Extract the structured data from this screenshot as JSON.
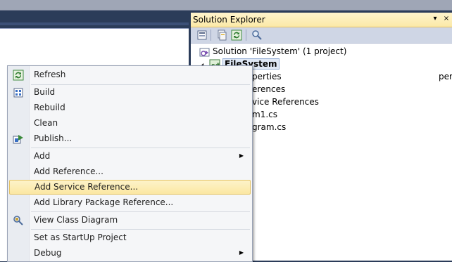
{
  "solution_explorer": {
    "title": "Solution Explorer",
    "pin_glyph": "▾",
    "autohide_glyph": "⊿",
    "close_glyph": "×",
    "toolbar_icons": [
      "properties-icon",
      "show-all-files-icon",
      "refresh-icon",
      "class-view-icon"
    ],
    "tree": [
      {
        "label": "Solution 'FileSystem' (1 project)",
        "icon": "solution-icon"
      },
      {
        "label": "FileSystem",
        "icon": "csharp-project-icon",
        "expander": "◢",
        "selected": true
      },
      {
        "label": "perties",
        "icon": ""
      },
      {
        "label": "erences",
        "icon": ""
      },
      {
        "label": "vice References",
        "icon": ""
      },
      {
        "label": "m1.cs",
        "icon": ""
      },
      {
        "label": "gram.cs",
        "icon": ""
      }
    ]
  },
  "context_menu": {
    "items": [
      {
        "label": "Refresh",
        "icon": "refresh-icon"
      },
      {
        "label": "Build",
        "icon": "build-icon"
      },
      {
        "label": "Rebuild",
        "icon": ""
      },
      {
        "label": "Clean",
        "icon": ""
      },
      {
        "label": "Publish...",
        "icon": "publish-icon"
      },
      {
        "label": "Add",
        "submenu": "▶"
      },
      {
        "label": "Add Reference...",
        "icon": ""
      },
      {
        "label": "Add Service Reference...",
        "icon": "",
        "highlighted": true
      },
      {
        "label": "Add Library Package Reference...",
        "icon": ""
      },
      {
        "label": "View Class Diagram",
        "icon": "class-diagram-icon"
      },
      {
        "label": "Set as StartUp Project",
        "icon": ""
      },
      {
        "label": "Debug",
        "submenu": "▶"
      }
    ]
  },
  "colors": {
    "chrome": "#2b3c59",
    "highlight": "#fbe7a2",
    "title_bar": "#fbe9a8"
  }
}
